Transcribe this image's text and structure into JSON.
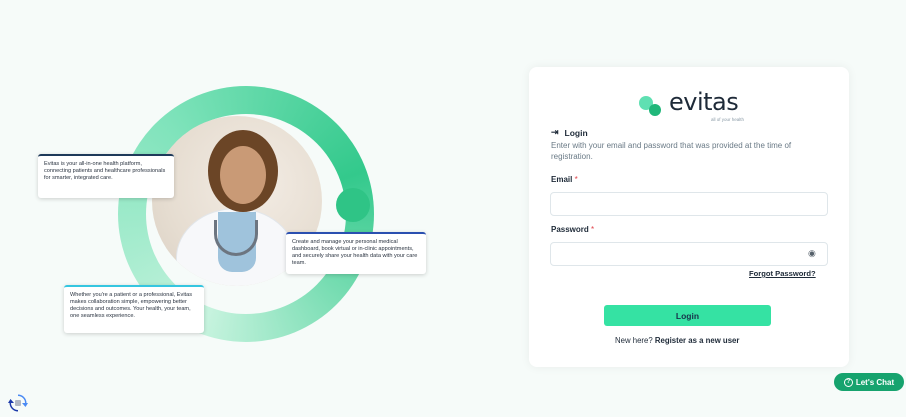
{
  "hero": {
    "card1_text": "Evitas is your all-in-one health platform, connecting patients and healthcare professionals for smarter, integrated care.",
    "card2_text": "Create and manage your personal medical dashboard, book virtual or in-clinic appointments, and securely share your health data with your care team.",
    "card3_text": "Whether you're a patient or a professional, Evitas makes collaboration simple, empowering better decisions and outcomes. Your health, your team, one seamless experience."
  },
  "logo": {
    "word": "evitas",
    "tagline": "all of your health"
  },
  "login": {
    "heading": "Login",
    "description": "Enter with your email and password that was provided at the time of registration.",
    "email_label": "Email",
    "email_value": "",
    "email_placeholder": "",
    "password_label": "Password",
    "password_value": "",
    "password_placeholder": "",
    "required_mark": "*",
    "forgot_label": "Forgot Password?",
    "login_button": "Login",
    "register_prompt": "New here?",
    "register_link": "Register as a new user"
  },
  "chat": {
    "label": "Let's Chat",
    "icon": "?"
  },
  "colors": {
    "accent": "#35e2a3",
    "brand_green": "#20b77a",
    "chat_bg": "#16a36e",
    "required": "#e0434a"
  },
  "icons": [
    "login-arrow-icon",
    "eye-icon",
    "help-icon",
    "recaptcha-icon",
    "evitas-logo-icon"
  ]
}
